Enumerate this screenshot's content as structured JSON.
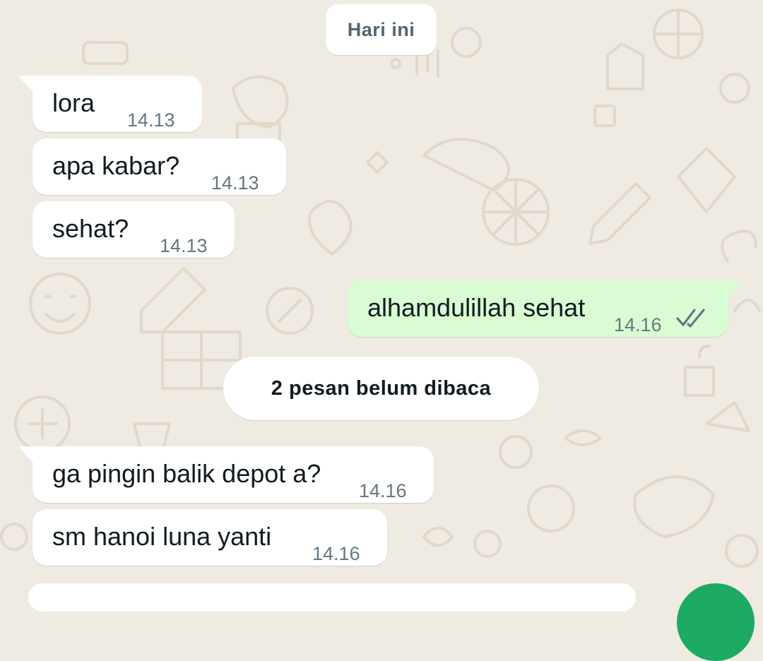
{
  "chat": {
    "date_chip": "Hari ini",
    "unread_chip": "2 pesan belum dibaca",
    "messages": [
      {
        "direction": "incoming",
        "text": "lora",
        "time": "14.13"
      },
      {
        "direction": "incoming",
        "text": "apa kabar?",
        "time": "14.13"
      },
      {
        "direction": "incoming",
        "text": "sehat?",
        "time": "14.13"
      },
      {
        "direction": "outgoing",
        "text": "alhamdulillah sehat",
        "time": "14.16",
        "status_icon": "double-check-icon"
      },
      {
        "direction": "incoming",
        "text": "ga pingin balik depot a?",
        "time": "14.16"
      },
      {
        "direction": "incoming",
        "text": "sm hanoi luna yanti",
        "time": "14.16"
      }
    ]
  },
  "colors": {
    "wallpaper": "#efeae2",
    "wallpaper_doodle": "#e2d8c8",
    "incoming_bubble": "#ffffff",
    "outgoing_bubble": "#d9fdd3",
    "timestamp": "#667781",
    "ticks": "#667781",
    "fab": "#1daa61"
  }
}
